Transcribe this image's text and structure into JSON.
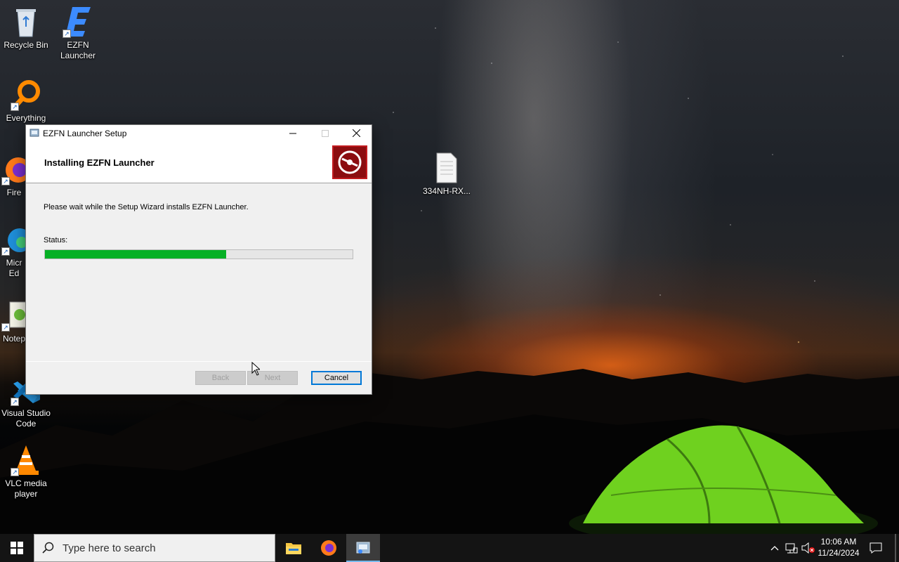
{
  "desktop": {
    "icons": [
      {
        "label": "Recycle Bin",
        "icon": "recycle-bin-icon"
      },
      {
        "label": "EZFN\nLauncher",
        "icon": "ezfn-icon"
      },
      {
        "label": "Everything",
        "icon": "everything-search-icon"
      },
      {
        "label": "Fire",
        "icon": "firefox-icon"
      },
      {
        "label": "Micr\nEd",
        "icon": "edge-icon"
      },
      {
        "label": "Notep",
        "icon": "notepad-plus-icon"
      },
      {
        "label": "Visual Studio\nCode",
        "icon": "vscode-icon"
      },
      {
        "label": "VLC media\nplayer",
        "icon": "vlc-icon"
      },
      {
        "label": "334NH-RX...",
        "icon": "text-file-icon"
      }
    ]
  },
  "installer": {
    "window_title": "EZFN Launcher Setup",
    "header_title": "Installing EZFN Launcher",
    "description": "Please wait while the Setup Wizard installs EZFN Launcher.",
    "status_label": "Status:",
    "progress_fraction": 0.59,
    "buttons": {
      "back": "Back",
      "next": "Next",
      "cancel": "Cancel"
    },
    "colors": {
      "progress_fill": "#06b025",
      "logo_bg": "#8b0d10"
    }
  },
  "taskbar": {
    "search_placeholder": "Type here to search",
    "time": "10:06 AM",
    "date": "11/24/2024"
  }
}
